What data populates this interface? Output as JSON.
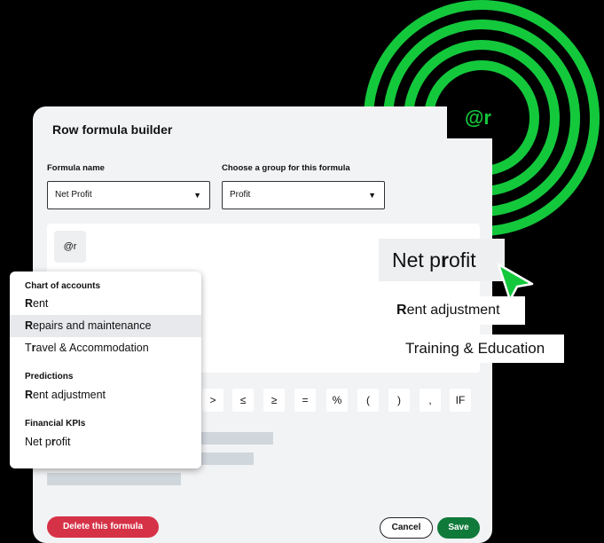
{
  "modal": {
    "title": "Row formula builder",
    "formula_name_label": "Formula name",
    "formula_name_value": "Net Profit",
    "group_label": "Choose a group for this formula",
    "group_value": "Profit",
    "editor_token": "@r",
    "operators": [
      ">",
      "≤",
      "≥",
      "=",
      "%",
      "(",
      ")",
      ",",
      "IF"
    ],
    "delete_label": "Delete this formula",
    "cancel_label": "Cancel",
    "save_label": "Save"
  },
  "target_badge": "@r",
  "dropdown": {
    "sections": [
      {
        "heading": "Chart of accounts",
        "items": [
          {
            "bold": "R",
            "rest": "ent"
          },
          {
            "bold": "R",
            "rest": "epairs and maintenance"
          },
          {
            "bold": "",
            "pre": "T",
            "mid": "r",
            "rest": "avel & Accommodation"
          }
        ]
      },
      {
        "heading": "Predictions",
        "items": [
          {
            "bold": "R",
            "rest": "ent adjustment"
          }
        ]
      },
      {
        "heading": "Financial KPIs",
        "items": [
          {
            "pre": "Net p",
            "mid": "r",
            "rest": "ofit"
          }
        ]
      }
    ]
  },
  "chips": {
    "big_pre": "Net p",
    "big_mid": "r",
    "big_post": "ofit",
    "mid_bold": "R",
    "mid_rest": "ent adjustment",
    "train": "Training & Education"
  },
  "colors": {
    "accent_green": "#14c83c",
    "save_green": "#107a3b",
    "delete_red": "#d63247",
    "highlight": "#e8e9ec"
  }
}
